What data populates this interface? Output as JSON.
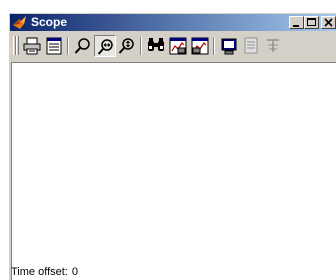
{
  "window": {
    "title": "Scope",
    "controls": {
      "minimize_icon": "minimize-icon",
      "restore_icon": "restore-icon",
      "close_icon": "close-icon"
    }
  },
  "toolbar": {
    "buttons": [
      {
        "icon": "print-icon"
      },
      {
        "icon": "parameters-icon"
      },
      {
        "icon": "zoom-icon"
      },
      {
        "icon": "zoom-x-icon",
        "pressed": true
      },
      {
        "icon": "zoom-y-icon"
      },
      {
        "icon": "autoscale-icon"
      },
      {
        "icon": "save-axes-settings-icon"
      },
      {
        "icon": "restore-axes-settings-icon"
      },
      {
        "icon": "floating-scope-icon"
      },
      {
        "icon": "signal-selector-icon"
      },
      {
        "icon": "lock-axes-icon"
      }
    ]
  },
  "status": {
    "time_offset_label": "Time offset:",
    "time_offset_value": "0"
  },
  "colors": {
    "title_gradient_start": "#0a246a",
    "title_gradient_end": "#a6caf0",
    "chrome": "#d4d0c8",
    "plot_background": "#ffffff"
  }
}
